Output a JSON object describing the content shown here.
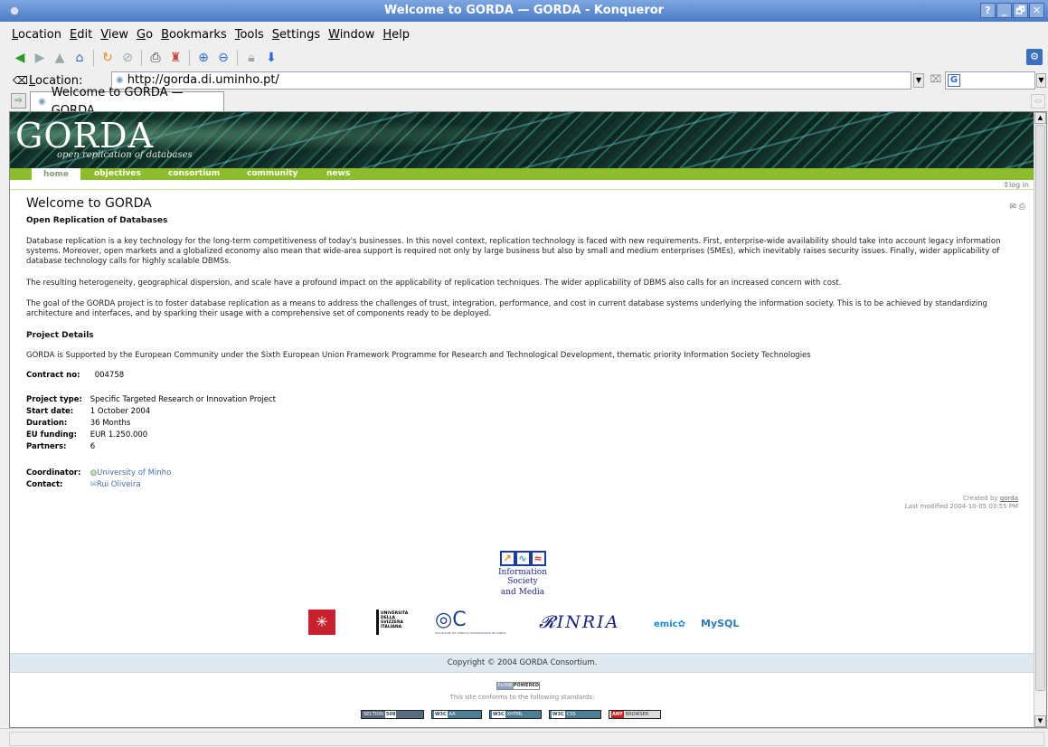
{
  "window": {
    "title": "Welcome to GORDA — GORDA - Konqueror",
    "controls": [
      "?",
      "_",
      "🗗",
      "✕"
    ]
  },
  "menubar": [
    "Location",
    "Edit",
    "View",
    "Go",
    "Bookmarks",
    "Tools",
    "Settings",
    "Window",
    "Help"
  ],
  "toolbar": {
    "icons": [
      "back-icon",
      "forward-icon",
      "up-icon",
      "home-icon",
      "reload-icon",
      "stop-icon",
      "print-icon",
      "find-icon",
      "zoom-in-icon",
      "zoom-out-icon",
      "security-icon",
      "download-icon"
    ]
  },
  "location": {
    "label": "Location:",
    "url": "http://gorda.di.uminho.pt/"
  },
  "tab": {
    "title": "Welcome to GORDA — GORDA"
  },
  "site": {
    "logo": "GORDA",
    "tagline": "open replication of databases",
    "nav": [
      "home",
      "objectives",
      "consortium",
      "community",
      "news"
    ],
    "login": "log in"
  },
  "page": {
    "title": "Welcome to GORDA",
    "section1": "Open Replication of Databases",
    "p1": "Database replication is a key technology for the long-term competitiveness of today's businesses. In this novel context, replication technology is faced with new requirements. First, enterprise-wide availability should take into account legacy information systems. Moreover, open markets and a globalized economy also mean that wide-area support is required not only by large business but also by small and medium enterprises (SMEs), which inevitably raises security issues. Finally, wider applicability of database technology calls for highly scalable DBMSs.",
    "p2": "The resulting heterogeneity, geographical dispersion, and scale have a profound impact on the applicability of replication techniques. The wider applicability of DBMS also calls for an increased concern with cost.",
    "p3": "The goal of the GORDA project is to foster database replication as a means to address the challenges of trust, integration, performance, and cost in current database systems underlying the information society. This is to be achieved by standardizing architecture and interfaces, and by sparking their usage with a comprehensive set of components ready to be deployed.",
    "section2": "Project Details",
    "p4": "GORDA is Supported by the European Community under the Sixth European Union Framework Programme for Research and Technological Development, thematic priority Information Society Technologies",
    "contract_label": "Contract no:",
    "contract_value": "004758",
    "type_label": "Project type:",
    "type_value": "Specific Targeted Research or Innovation Project",
    "start_label": "Start date:",
    "start_value": "1 October 2004",
    "duration_label": "Duration:",
    "duration_value": "36 Months",
    "funding_label": "EU funding:",
    "funding_value": "EUR 1.250.000",
    "partners_label": "Partners:",
    "partners_value": "6",
    "coordinator_label": "Coordinator:",
    "coordinator_value": "University of Minho",
    "contact_label": "Contact:",
    "contact_value": "Rui Oliveira",
    "created_prefix": "Created by",
    "created_by": "gorda",
    "last_modified": "Last modified 2004-10-05 03:55 PM"
  },
  "partners_logos": {
    "ism_line1": "Information Society",
    "ism_line2": "and Media",
    "usi": "UNIVERSITA DELLA SVIZZERA ITALIANA",
    "fcul": "FACULDADE DE CIÊNCIAS UNIVERSIDADE DE LISBOA",
    "inria": "INRIA",
    "emic": "emic",
    "mysql": "MySQL"
  },
  "footer": {
    "copyright": "Copyright © 2004 GORDA Consortium.",
    "powered_left": "PLONE",
    "powered_right": "POWERED",
    "conform": "This site conforms to the following standards:",
    "badges": [
      "SECTION",
      "508",
      "W3C",
      "AA",
      "W3C",
      "XHTML",
      "W3C",
      "CSS",
      "ANY",
      "BROWSER"
    ]
  }
}
